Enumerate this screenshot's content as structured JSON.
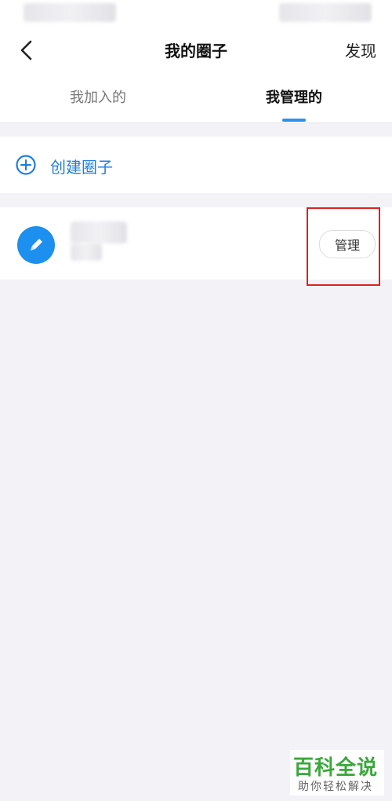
{
  "header": {
    "title": "我的圈子",
    "right_action": "发现",
    "back_icon": "chevron-left-icon"
  },
  "tabs": [
    {
      "label": "我加入的",
      "active": false
    },
    {
      "label": "我管理的",
      "active": true
    }
  ],
  "create": {
    "label": "创建圈子",
    "icon": "plus-circle-icon"
  },
  "circle": {
    "avatar_icon": "pencil-icon",
    "manage_label": "管理"
  },
  "watermark": {
    "title": "百科全说",
    "subtitle": "助你轻松解决"
  },
  "colors": {
    "accent": "#2d8ff0",
    "link": "#1f7fe0",
    "avatar": "#1c8fef",
    "highlight": "#e02020",
    "watermark": "#3aa83a",
    "background": "#f3f3f7"
  }
}
